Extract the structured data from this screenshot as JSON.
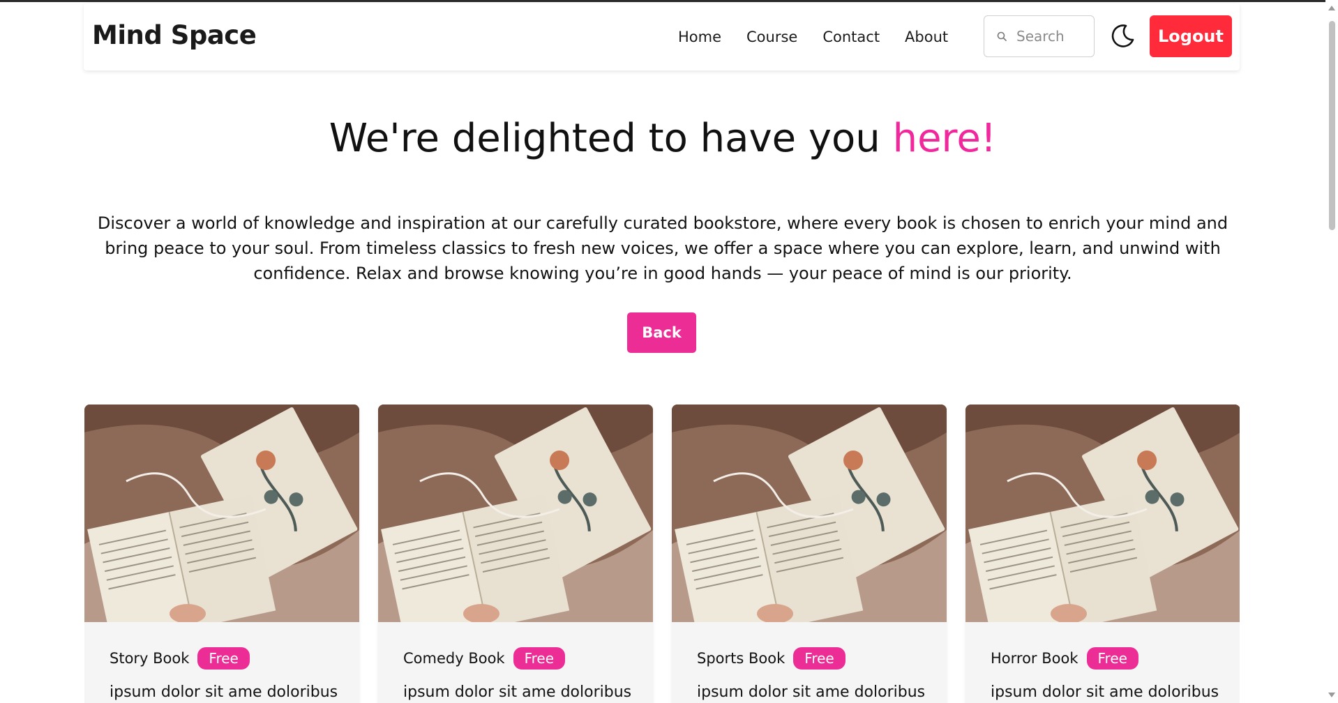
{
  "brand": "Mind Space",
  "nav": {
    "items": [
      {
        "label": "Home"
      },
      {
        "label": "Course"
      },
      {
        "label": "Contact"
      },
      {
        "label": "About"
      }
    ],
    "search_placeholder": "Search",
    "theme_icon": "moon-icon",
    "logout_label": "Logout"
  },
  "hero": {
    "title_main": "We're delighted to have you ",
    "title_accent": "here!",
    "description": "Discover a world of knowledge and inspiration at our carefully curated bookstore, where every book is chosen to enrich your mind and bring peace to your soul. From timeless classics to fresh new voices, we offer a space where you can explore, learn, and unwind with confidence. Relax and browse knowing you’re in good hands — your peace of mind is our priority.",
    "back_label": "Back"
  },
  "cards": [
    {
      "title": "Story Book",
      "badge": "Free",
      "description": "ipsum dolor sit ame doloribus"
    },
    {
      "title": "Comedy Book",
      "badge": "Free",
      "description": "ipsum dolor sit ame doloribus"
    },
    {
      "title": "Sports Book",
      "badge": "Free",
      "description": "ipsum dolor sit ame doloribus"
    },
    {
      "title": "Horror Book",
      "badge": "Free",
      "description": "ipsum dolor sit ame doloribus"
    }
  ],
  "colors": {
    "accent_pink": "#ec2d95",
    "logout_red": "#ff2b3a",
    "text": "#111111"
  }
}
